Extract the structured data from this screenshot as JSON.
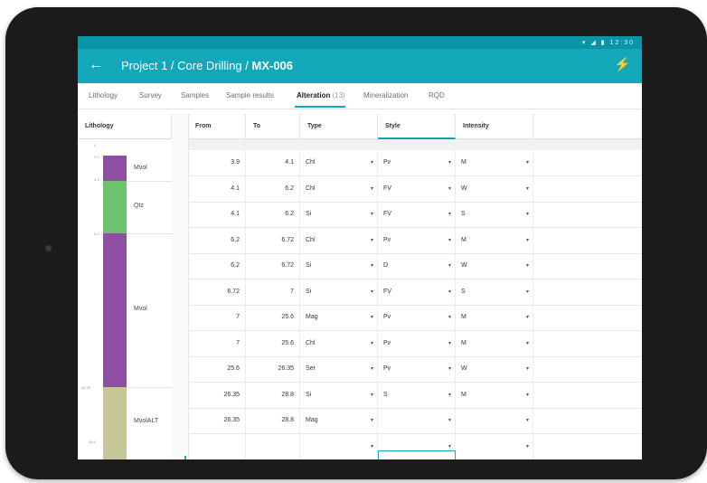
{
  "status_bar": {
    "time": "12:30"
  },
  "app_bar": {
    "title_prefix": "Project 1 / Core Drilling / ",
    "title_bold": "MX-006"
  },
  "tabs": [
    {
      "label": "Lithology"
    },
    {
      "label": "Survey"
    },
    {
      "label": "Samples"
    },
    {
      "label": "Sample results"
    },
    {
      "label": "Alteration",
      "count": "(13)",
      "active": true
    },
    {
      "label": "Mineralization"
    },
    {
      "label": "RQD"
    }
  ],
  "columns": {
    "lithology": "Lithology",
    "from": "From",
    "to": "To",
    "type": "Type",
    "style": "Style",
    "intensity": "Intensity"
  },
  "lithology": {
    "depth_ticks": [
      "0",
      "3.9",
      "4.1",
      "6.2",
      "26.35",
      "28.8"
    ],
    "units": [
      {
        "label": "Mvol",
        "color": "#8e4fa2",
        "from": 3.9,
        "to": 4.1
      },
      {
        "label": "Qtz",
        "color": "#6cc36c",
        "from": 4.1,
        "to": 6.2
      },
      {
        "label": "Mvol",
        "color": "#8e4fa2",
        "from": 6.2,
        "to": 26.35
      },
      {
        "label": "MvolALT",
        "color": "#c8c596",
        "from": 26.35,
        "to": 28.8
      }
    ]
  },
  "rows": [
    {
      "from": "3.9",
      "to": "4.1",
      "type": "Chl",
      "style": "Pv",
      "intensity": "M"
    },
    {
      "from": "4.1",
      "to": "6.2",
      "type": "Chl",
      "style": "FV",
      "intensity": "W"
    },
    {
      "from": "4.1",
      "to": "6.2",
      "type": "Si",
      "style": "FV",
      "intensity": "S"
    },
    {
      "from": "6.2",
      "to": "6.72",
      "type": "Chl",
      "style": "Pv",
      "intensity": "M"
    },
    {
      "from": "6.2",
      "to": "6.72",
      "type": "Si",
      "style": "D",
      "intensity": "W"
    },
    {
      "from": "6.72",
      "to": "7",
      "type": "Si",
      "style": "FV",
      "intensity": "S"
    },
    {
      "from": "7",
      "to": "25.6",
      "type": "Mag",
      "style": "Pv",
      "intensity": "M"
    },
    {
      "from": "7",
      "to": "25.6",
      "type": "Chl",
      "style": "Pv",
      "intensity": "M"
    },
    {
      "from": "25.6",
      "to": "26.35",
      "type": "Ser",
      "style": "Pv",
      "intensity": "W"
    },
    {
      "from": "26.35",
      "to": "28.8",
      "type": "Si",
      "style": "S",
      "intensity": "M"
    },
    {
      "from": "26.35",
      "to": "28.8",
      "type": "Mag",
      "style": "",
      "intensity": ""
    },
    {
      "from": "",
      "to": "",
      "type": "",
      "style": "",
      "intensity": ""
    }
  ],
  "colors": {
    "accent": "#12a7b9",
    "statusbar": "#0b93a6",
    "bolt": "#ffd84d"
  }
}
